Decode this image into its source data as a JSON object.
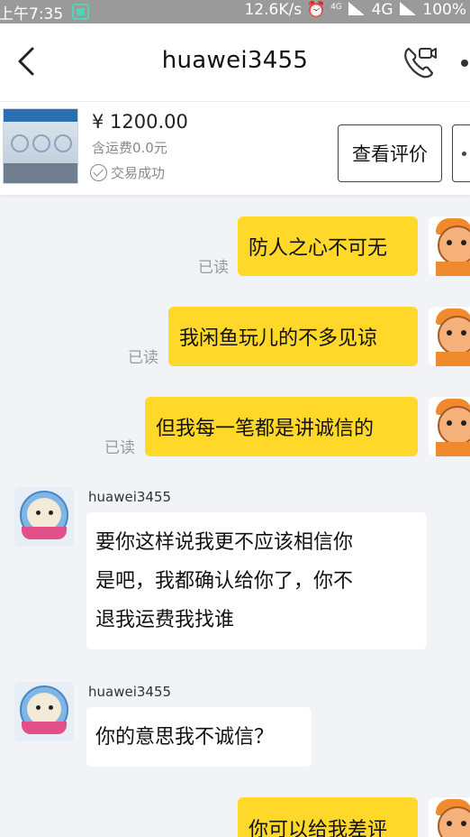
{
  "status_bar": {
    "time": "上午7:35",
    "speed": "12.6K/s",
    "network_small": "4G",
    "network": "4G",
    "battery": "100%"
  },
  "header": {
    "title": "huawei3455"
  },
  "product": {
    "price": "¥ 1200.00",
    "shipping": "含运费0.0元",
    "status": "交易成功",
    "review_button": "查看评价"
  },
  "messages": [
    {
      "from": "me",
      "text": "防人之心不可无",
      "read": "已读"
    },
    {
      "from": "me",
      "text": "我闲鱼玩儿的不多见谅",
      "read": "已读"
    },
    {
      "from": "me",
      "text": "但我每一笔都是讲诚信的",
      "read": "已读"
    },
    {
      "from": "them",
      "sender": "huawei3455",
      "lines": [
        "要你这样说我更不应该相信你",
        "是吧，我都确认给你了，你不",
        "退我运费我找谁"
      ]
    },
    {
      "from": "them",
      "sender": "huawei3455",
      "lines": [
        "你的意思我不诚信？"
      ]
    },
    {
      "from": "me",
      "text": "你可以给我差评"
    }
  ],
  "colors": {
    "outgoing_bubble": "#ffd829",
    "incoming_bubble": "#ffffff",
    "background": "#f2f3f7",
    "status_bar": "#9a9a9a"
  }
}
